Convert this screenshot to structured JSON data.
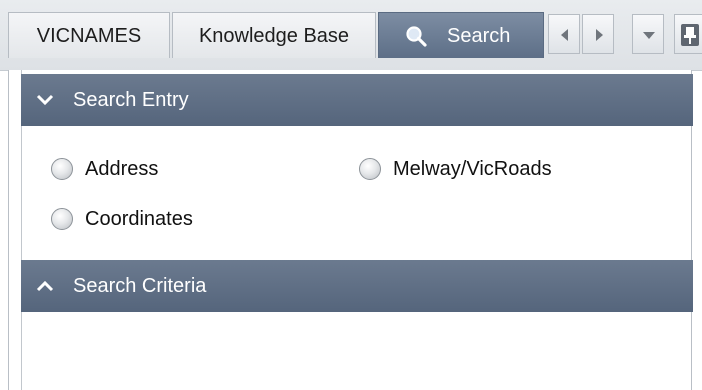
{
  "tabs": {
    "vicnames": "VICNAMES",
    "knowledge_base": "Knowledge Base",
    "search": "Search"
  },
  "tab_controls": {
    "scroll_left_icon": "triangle-left-icon",
    "scroll_right_icon": "triangle-right-icon",
    "menu_icon": "triangle-down-icon",
    "pin_icon": "pin-icon"
  },
  "sections": {
    "search_entry": {
      "title": "Search Entry",
      "expanded": true,
      "options": {
        "address": "Address",
        "melway": "Melway/VicRoads",
        "coordinates": "Coordinates"
      }
    },
    "search_criteria": {
      "title": "Search Criteria",
      "expanded": false
    }
  },
  "colors": {
    "header_bg": "#5d6d83",
    "active_tab_bg": "#6b7c93",
    "text": "#1d1d1d"
  }
}
